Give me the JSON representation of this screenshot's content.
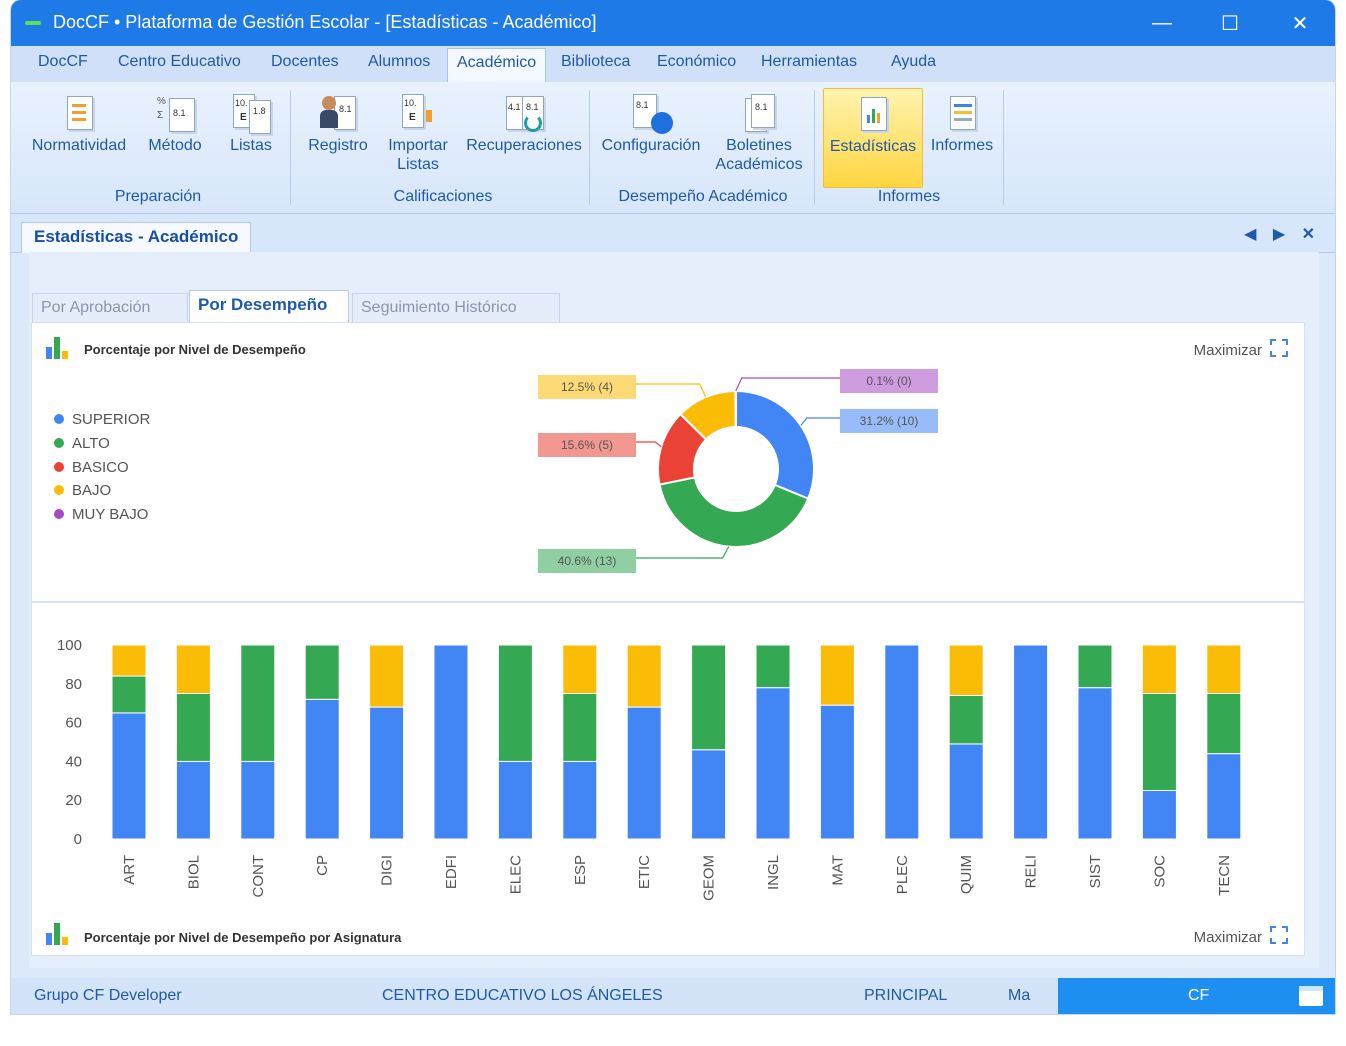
{
  "window": {
    "title": "DocCF • Plataforma de Gestión Escolar  - [Estadísticas - Académico]",
    "minimize_glyph": "—",
    "maximize_glyph": "☐",
    "close_glyph": "✕"
  },
  "menu": {
    "items": [
      "DocCF",
      "Centro Educativo",
      "Docentes",
      "Alumnos",
      "Académico",
      "Biblioteca",
      "Económico",
      "Herramientas",
      "Ayuda"
    ],
    "active": "Académico"
  },
  "ribbon": {
    "buttons": {
      "normatividad": "Normatividad",
      "metodo": "Método",
      "listas": "Listas",
      "registro": "Registro",
      "importar_1": "Importar",
      "importar_2": "Listas",
      "recuperaciones": "Recuperaciones",
      "configuracion": "Configuración",
      "boletines_1": "Boletines",
      "boletines_2": "Académicos",
      "estadisticas": "Estadísticas",
      "informes": "Informes"
    },
    "groups": {
      "preparacion": "Preparación",
      "calificaciones": "Calificaciones",
      "desempeno": "Desempeño Académico",
      "informes": "Informes"
    },
    "icon_texts": {
      "pct": "%",
      "sigma": "Σ",
      "score_81": "8.1",
      "score_10": "10.",
      "score_18": "1.8",
      "score_41": "4.1",
      "letter_e": "E"
    }
  },
  "document_tab": {
    "label": "Estadísticas - Académico",
    "nav": "◀ ▶",
    "close": "✕"
  },
  "subtabs": [
    "Por Aprobación",
    "Por Desempeño",
    "Seguimiento Histórico"
  ],
  "donut_panel": {
    "title": "Porcentaje por Nivel de Desempeño",
    "maximize": "Maximizar"
  },
  "bar_panel": {
    "title": "Porcentaje por Nivel de Desempeño por Asignatura",
    "maximize": "Maximizar"
  },
  "colors": {
    "superior": "#4285f4",
    "alto": "#34a853",
    "basico": "#ea4335",
    "bajo": "#fbbc05",
    "muy_bajo": "#a64bc4",
    "accent": "#1e7ae6"
  },
  "chart_data": [
    {
      "type": "pie",
      "title": "Porcentaje por Nivel de Desempeño",
      "donut": true,
      "legend_position": "left",
      "slices": [
        {
          "name": "SUPERIOR",
          "value": 31.2,
          "count": 10,
          "label": "31.2% (10)",
          "color": "#4285f4"
        },
        {
          "name": "ALTO",
          "value": 40.6,
          "count": 13,
          "label": "40.6% (13)",
          "color": "#34a853"
        },
        {
          "name": "BASICO",
          "value": 15.6,
          "count": 5,
          "label": "15.6% (5)",
          "color": "#ea4335"
        },
        {
          "name": "BAJO",
          "value": 12.5,
          "count": 4,
          "label": "12.5% (4)",
          "color": "#fbbc05"
        },
        {
          "name": "MUY BAJO",
          "value": 0.1,
          "count": 0,
          "label": "0.1% (0)",
          "color": "#a64bc4"
        }
      ]
    },
    {
      "type": "bar",
      "stacked": true,
      "title": "Porcentaje por Nivel de Desempeño por Asignatura",
      "categories": [
        "ART",
        "BIOL",
        "CONT",
        "CP",
        "DIGI",
        "EDFI",
        "ELEC",
        "ESP",
        "ETIC",
        "GEOM",
        "INGL",
        "MAT",
        "PLEC",
        "QUIM",
        "RELI",
        "SIST",
        "SOC",
        "TECN"
      ],
      "ylim": [
        0,
        100
      ],
      "yticks": [
        0,
        20,
        40,
        60,
        80,
        100
      ],
      "series": [
        {
          "name": "SUPERIOR",
          "color": "#4285f4",
          "values": [
            65,
            40,
            40,
            72,
            68,
            100,
            40,
            40,
            68,
            46,
            78,
            69,
            100,
            49,
            100,
            78,
            25,
            44
          ]
        },
        {
          "name": "ALTO",
          "color": "#34a853",
          "values": [
            19,
            35,
            60,
            28,
            0,
            0,
            60,
            35,
            0,
            54,
            22,
            0,
            0,
            25,
            0,
            22,
            50,
            31
          ]
        },
        {
          "name": "BAJO",
          "color": "#fbbc05",
          "values": [
            16,
            25,
            0,
            0,
            32,
            0,
            0,
            25,
            32,
            0,
            0,
            31,
            0,
            26,
            0,
            0,
            25,
            25
          ]
        }
      ]
    }
  ],
  "statusbar": {
    "company": "Grupo CF Developer",
    "school": "CENTRO EDUCATIVO LOS ÁNGELES",
    "branch": "PRINCIPAL",
    "shift": "Ma",
    "user": "CF"
  }
}
